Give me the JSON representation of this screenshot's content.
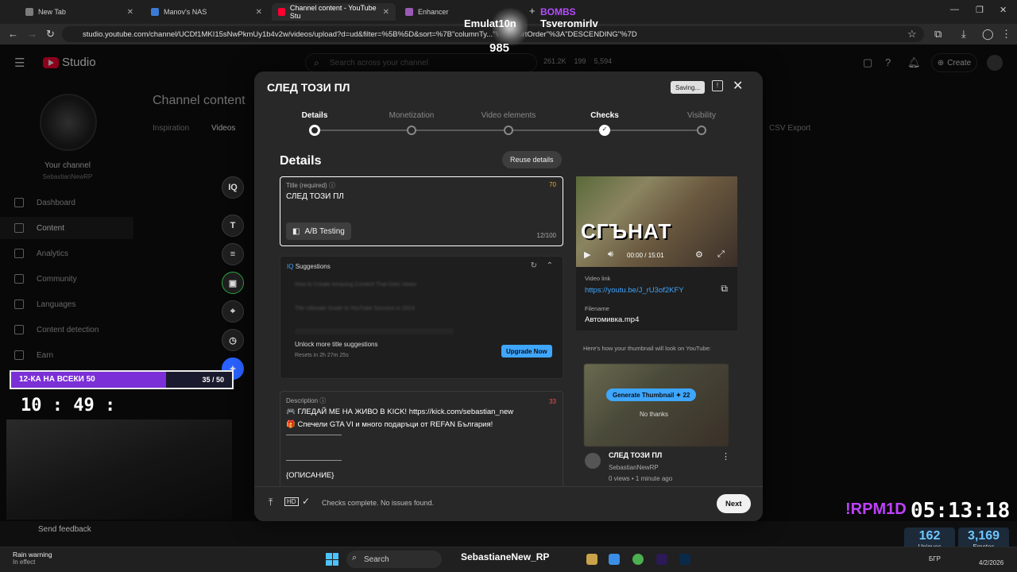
{
  "browser": {
    "tabs": [
      {
        "label": "New Tab",
        "color": "#7c7c7c"
      },
      {
        "label": "Manov's NAS",
        "color": "#3a7bd5"
      },
      {
        "label": "Channel content - YouTube Stu",
        "color": "#ff0033"
      },
      {
        "label": "Enhancer",
        "color": "#9b59b6"
      }
    ],
    "url": "studio.youtube.com/channel/UCDf1MKI15sNwPkmUy1b4v2w/videos/upload?d=ud&filter=%5B%5D&sort=%7B\"columnTy...\"%2C\"sortOrder\"%3A\"DESCENDING\"%7D"
  },
  "studio": {
    "logo_text": "Studio",
    "search_placeholder": "Search across your channel",
    "stats": [
      "261.2K",
      "199",
      "5,594"
    ],
    "create_label": "Create",
    "your_channel": "Your channel",
    "channel_name": "SebastianNewRP",
    "nav": [
      "Dashboard",
      "Content",
      "Analytics",
      "Community",
      "Languages",
      "Content detection",
      "Earn"
    ],
    "send_feedback": "Send feedback",
    "page_title": "Channel content",
    "subtabs": [
      "Inspiration",
      "Videos"
    ],
    "csv_export": "CSV Export"
  },
  "modal": {
    "title": "СЛЕД ТОЗИ ПЛ",
    "saving": "Saving...",
    "steps": [
      "Details",
      "Monetization",
      "Video elements",
      "Checks",
      "Visibility"
    ],
    "section_heading": "Details",
    "reuse_label": "Reuse details",
    "title_field": {
      "label": "Title (required)",
      "value": "СЛЕД ТОЗИ ПЛ",
      "score": "70",
      "length": "12/100"
    },
    "ab_testing": "A/B Testing",
    "suggestions": {
      "heading": "Suggestions",
      "items": [
        "How to Create Amazing Content That Gets Views",
        "The Ultimate Guide to YouTube Success in 2024"
      ],
      "unlock": "Unlock more title suggestions",
      "resets": "Resets in 2h 27m 25s",
      "upgrade": "Upgrade Now"
    },
    "description": {
      "label": "Description",
      "count": "33",
      "lines": [
        "🎮 ГЛЕДАЙ МЕ НА ЖИВО В KICK! https://kick.com/sebastian_new",
        "🎁 Спечели GTA VI и много подаръци от REFAN България!",
        "——————————",
        "",
        "——————————",
        "{ОПИСАНИЕ}"
      ]
    },
    "thumbnail_text": "СГЪНАТ",
    "player_time": "00:00 / 15:01",
    "video_link_label": "Video link",
    "video_link": "https://youtu.be/J_rU3of2KFY",
    "filename_label": "Filename",
    "filename": "Автомивка.mp4",
    "thumb_preview_label": "Here's how your thumbnail will look on YouTube:",
    "generate_thumbnail": "Generate Thumbnail ✦ 22",
    "no_thanks": "No thanks",
    "preview_title": "СЛЕД ТОЗИ ПЛ",
    "preview_channel": "SebastianNewRP",
    "preview_meta": "0 views • 1 minute ago",
    "checks_status": "Checks complete. No issues found.",
    "next": "Next"
  },
  "rail_tools": [
    "IQ",
    "T",
    "≡",
    "▣",
    "⌖",
    "◷",
    "✦"
  ],
  "overlay": {
    "goal_label": "12-КА НА ВСЕКИ 50",
    "goal_count": "35 / 50",
    "goal_progress": 0.7,
    "clock": "10 : 49 :",
    "top_name1": "Emulat10n",
    "top_name2": "Tsveromirlv",
    "top_bombs": "BOMBS",
    "top_count": "985",
    "rpm": "!RPM1D",
    "timer": "05:13:18",
    "uniques_value": "162",
    "uniques_label": "Uniques",
    "emotes_value": "3,169",
    "emotes_label": "Emotes"
  },
  "taskbar": {
    "weather_title": "Rain warning",
    "weather_sub": "In effect",
    "search": "Search",
    "streamer": "SebastianeNew_RP",
    "lang": "БГР",
    "date": "4/2/2026"
  }
}
